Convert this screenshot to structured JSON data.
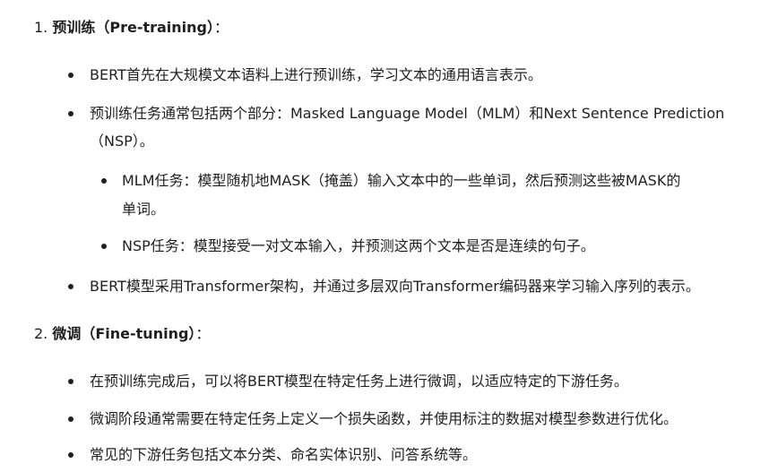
{
  "sections": [
    {
      "number": "1.",
      "title": "预训练（Pre-training）",
      "suffix": "：",
      "bullets": [
        {
          "lines": [
            "BERT首先在大规模文本语料上进行预训练，学习文本的通用语言表示。"
          ]
        },
        {
          "lines": [
            "预训练任务通常包括两个部分：Masked Language Model（MLM）和Next Sentence Prediction",
            "（NSP）。"
          ]
        },
        {
          "lines": [
            "MLM任务：模型随机地MASK（掩盖）输入文本中的一些单词，然后预测这些被MASK的",
            "单词。"
          ],
          "nested": true
        },
        {
          "lines": [
            "NSP任务：模型接受一对文本输入，并预测这两个文本是否是连续的句子。"
          ],
          "nested": true
        },
        {
          "lines": [
            "BERT模型采用Transformer架构，并通过多层双向Transformer编码器来学习输入序列的表示。"
          ]
        }
      ]
    },
    {
      "number": "2.",
      "title": "微调（Fine-tuning）",
      "suffix": "：",
      "bullets": [
        {
          "lines": [
            "在预训练完成后，可以将BERT模型在特定任务上进行微调，以适应特定的下游任务。"
          ]
        },
        {
          "lines": [
            "微调阶段通常需要在特定任务上定义一个损失函数，并使用标注的数据对模型参数进行优化。"
          ]
        },
        {
          "lines": [
            "常见的下游任务包括文本分类、命名实体识别、问答系统等。"
          ]
        }
      ]
    }
  ]
}
